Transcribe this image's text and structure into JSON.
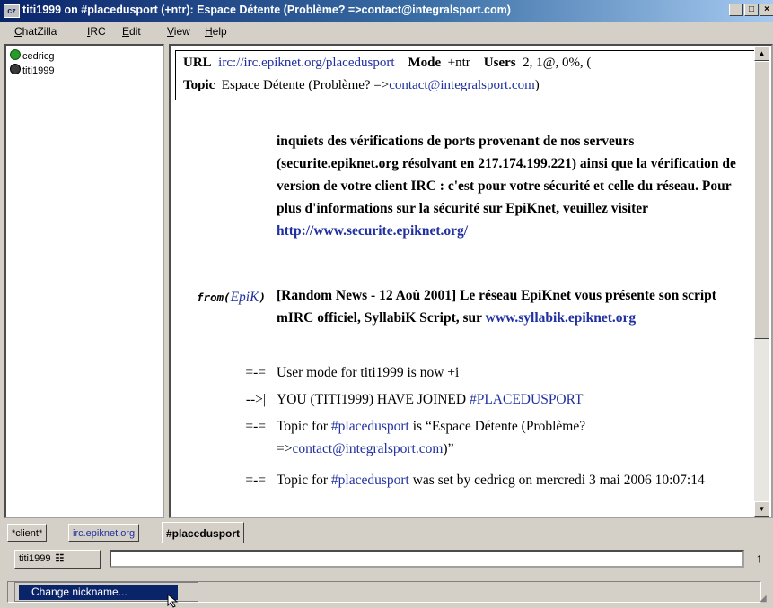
{
  "window": {
    "title": "titi1999 on #placedusport (+ntr): Espace Détente (Problème? =>contact@integralsport.com)",
    "app_icon": "cz",
    "controls": [
      "_",
      "□",
      "×"
    ]
  },
  "menu": [
    "ChatZilla",
    "IRC",
    "Edit",
    "View",
    "Help"
  ],
  "userlist": [
    {
      "nick": "cedricg",
      "status": "op"
    },
    {
      "nick": "titi1999",
      "status": "normal"
    }
  ],
  "channel_header": {
    "url_label": "URL",
    "url_value": "irc://irc.epiknet.org/placedusport",
    "mode_label": "Mode",
    "mode_value": "+ntr",
    "users_label": "Users",
    "users_value": "2, 1@, 0%, (",
    "topic_label": "Topic",
    "topic_text": "Espace Détente (Problème? =>",
    "topic_link": "contact@integralsport.com",
    "topic_end": ")"
  },
  "messages": [
    {
      "from": "",
      "text": "inquiets des vérifications de ports provenant de nos serveurs (securite.epiknet.org résolvant en 217.174.199.221) ainsi que la vérification de version de votre client IRC : c'est pour votre sécurité et celle du réseau. Pour plus d'informations sur la sécurité sur EpiKnet, veuillez visiter",
      "link": "http://www.securite.epiknet.org/"
    },
    {
      "from_prefix": "from(",
      "from_nick": "EpiK",
      "from_suffix": ")",
      "text": "[Random News - 12 Aoû 2001] Le réseau EpiKnet vous présente son script mIRC officiel, SyllabiK Script, sur",
      "link": "www.syllabik.epiknet.org"
    },
    {
      "from": "=-=",
      "text": "User mode for titi1999 is now +i"
    },
    {
      "from": "-->|",
      "text": "YOU (TITI1999) HAVE JOINED",
      "link": "#PLACEDUSPORT"
    },
    {
      "from": "=-=",
      "text_a": "Topic for",
      "link": "#placedusport",
      "text_b": "is “Espace Détente (Problème? =>",
      "link2": "contact@integralsport.com",
      "text_c": ")”"
    },
    {
      "from": "=-=",
      "text_a": "Topic for",
      "link": "#placedusport",
      "text_b": "was set by cedricg on mercredi 3 mai 2006 10:07:14"
    }
  ],
  "tabs": [
    {
      "label": "*client*",
      "active": false
    },
    {
      "label": "irc.epiknet.org",
      "active": false
    },
    {
      "label": "#placedusport",
      "active": true
    }
  ],
  "input": {
    "nick_button": "titi1999",
    "value": ""
  },
  "context_menu": {
    "item": "Change nickname..."
  }
}
